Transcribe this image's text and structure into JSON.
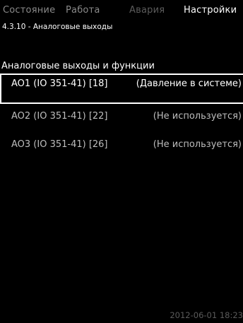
{
  "tabs": {
    "status": "Состояние",
    "work": "Работа",
    "alarm": "Авария",
    "settings": "Настройки"
  },
  "breadcrumb": "4.3.10 - Аналоговые выходы",
  "section_title": "Аналоговые выходы и функции",
  "outputs": [
    {
      "name": "AO1 (IO 351-41) [18]",
      "function": "(Давление в системе)",
      "selected": true
    },
    {
      "name": "AO2 (IO 351-41) [22]",
      "function": "(Не используется)",
      "selected": false
    },
    {
      "name": "AO3 (IO 351-41) [26]",
      "function": "(Не используется)",
      "selected": false
    }
  ],
  "datetime": "2012-06-01 18:23",
  "colors": {
    "background": "#000000",
    "active_text": "#ffffff",
    "inactive_text": "#8a8a8a"
  }
}
